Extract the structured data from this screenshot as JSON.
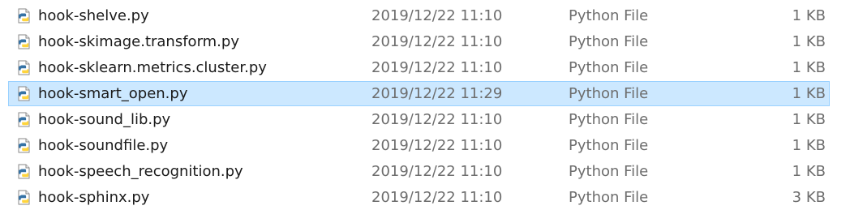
{
  "files": [
    {
      "name": "hook-shelve.py",
      "date_modified": "2019/12/22 11:10",
      "type": "Python File",
      "size": "1 KB",
      "icon": "python-file-icon",
      "selected": false
    },
    {
      "name": "hook-skimage.transform.py",
      "date_modified": "2019/12/22 11:10",
      "type": "Python File",
      "size": "1 KB",
      "icon": "python-file-icon",
      "selected": false
    },
    {
      "name": "hook-sklearn.metrics.cluster.py",
      "date_modified": "2019/12/22 11:10",
      "type": "Python File",
      "size": "1 KB",
      "icon": "python-file-icon",
      "selected": false
    },
    {
      "name": "hook-smart_open.py",
      "date_modified": "2019/12/22 11:29",
      "type": "Python File",
      "size": "1 KB",
      "icon": "python-file-icon",
      "selected": true
    },
    {
      "name": "hook-sound_lib.py",
      "date_modified": "2019/12/22 11:10",
      "type": "Python File",
      "size": "1 KB",
      "icon": "python-file-icon",
      "selected": false
    },
    {
      "name": "hook-soundfile.py",
      "date_modified": "2019/12/22 11:10",
      "type": "Python File",
      "size": "1 KB",
      "icon": "python-file-icon",
      "selected": false
    },
    {
      "name": "hook-speech_recognition.py",
      "date_modified": "2019/12/22 11:10",
      "type": "Python File",
      "size": "1 KB",
      "icon": "python-file-icon",
      "selected": false
    },
    {
      "name": "hook-sphinx.py",
      "date_modified": "2019/12/22 11:10",
      "type": "Python File",
      "size": "3 KB",
      "icon": "python-file-icon",
      "selected": false
    }
  ],
  "colors": {
    "selection_fill": "#cce8ff",
    "selection_border": "#99d1ff",
    "python_blue": "#3572a5",
    "python_yellow": "#ffd43b"
  }
}
